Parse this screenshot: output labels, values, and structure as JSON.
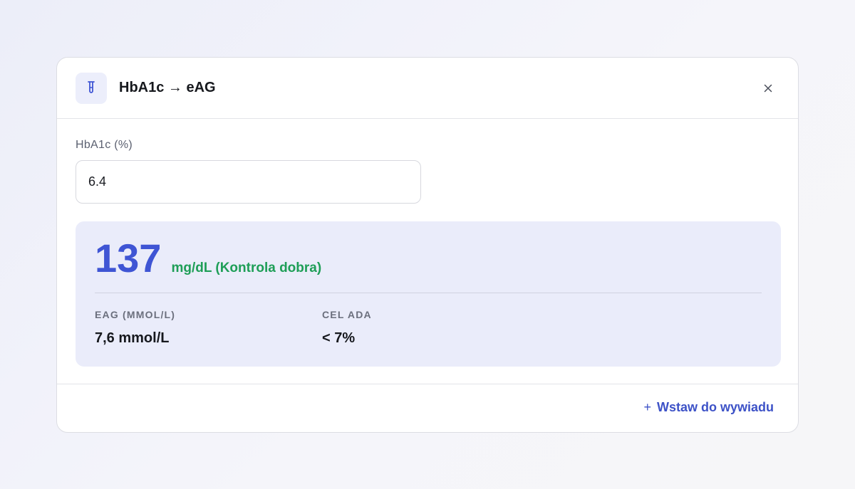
{
  "dialog": {
    "title": "HbA1c → eAG",
    "icon": "test-tube-icon",
    "close_icon": "close-icon"
  },
  "input": {
    "label": "HbA1c (%)",
    "value": "6.4"
  },
  "result": {
    "value": "137",
    "unit_status": "mg/dL (Kontrola dobra)",
    "accent_color": "#3f55d4",
    "status_color": "#1e9e57",
    "stats": [
      {
        "label": "EAG (MMOL/L)",
        "value": "7,6 mmol/L"
      },
      {
        "label": "CEL ADA",
        "value": "< 7%"
      }
    ]
  },
  "footer": {
    "plus_icon": "plus-icon",
    "insert_label": "Wstaw do wywiadu"
  }
}
